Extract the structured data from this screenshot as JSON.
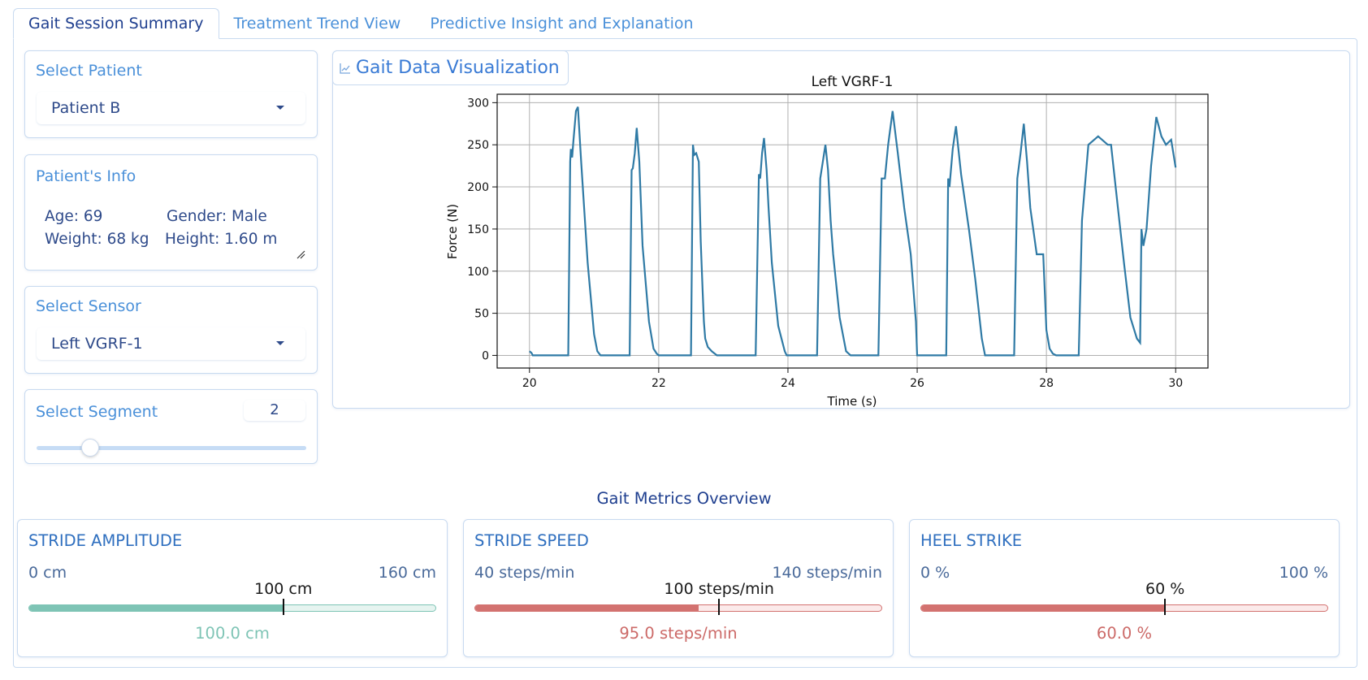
{
  "tabs": [
    {
      "label": "Gait Session Summary",
      "active": true
    },
    {
      "label": "Treatment Trend View",
      "active": false
    },
    {
      "label": "Predictive Insight and Explanation",
      "active": false
    }
  ],
  "patient_select": {
    "title": "Select Patient",
    "value": "Patient B"
  },
  "patient_info": {
    "title": "Patient's Info",
    "age": "Age: 69",
    "gender": "Gender: Male",
    "weight": "Weight: 68 kg",
    "height": "Height: 1.60 m"
  },
  "sensor_select": {
    "title": "Select Sensor",
    "value": "Left VGRF-1"
  },
  "segment": {
    "title": "Select Segment",
    "value": "2",
    "level_fraction": 0.2
  },
  "visualization": {
    "header_icon": "chart-icon",
    "title": "Gait Data Visualization"
  },
  "metrics_title": "Gait Metrics Overview",
  "metrics": [
    {
      "name": "stride-amplitude",
      "title": "STRIDE AMPLITUDE",
      "min_label": "0 cm",
      "max_label": "160 cm",
      "min": 0,
      "max": 160,
      "reference": 100,
      "reference_label": "100 cm",
      "value": 100,
      "value_label": "100.0 cm",
      "color": "#7ec4b5",
      "track_color": "#e6f4f0",
      "text_color": "#7ec4b5"
    },
    {
      "name": "stride-speed",
      "title": "STRIDE SPEED",
      "min_label": "40 steps/min",
      "max_label": "140 steps/min",
      "min": 40,
      "max": 140,
      "reference": 100,
      "reference_label": "100 steps/min",
      "value": 95,
      "value_label": "95.0 steps/min",
      "color": "#d37270",
      "track_color": "#fbeaea",
      "text_color": "#cc6a68"
    },
    {
      "name": "heel-strike",
      "title": "HEEL STRIKE",
      "min_label": "0 %",
      "max_label": "100 %",
      "min": 0,
      "max": 100,
      "reference": 60,
      "reference_label": "60 %",
      "value": 60,
      "value_label": "60.0 %",
      "color": "#d37270",
      "track_color": "#fbeaea",
      "text_color": "#cc6a68"
    }
  ],
  "chart_data": {
    "type": "line",
    "title": "Left VGRF-1",
    "xlabel": "Time (s)",
    "ylabel": "Force (N)",
    "xlim": [
      19.5,
      30.5
    ],
    "ylim": [
      -15,
      310
    ],
    "xticks": [
      20,
      22,
      24,
      26,
      28,
      30
    ],
    "yticks": [
      0,
      50,
      100,
      150,
      200,
      250,
      300
    ],
    "grid": true,
    "line_color": "#2f7aa5",
    "x": [
      20.0,
      20.03,
      20.05,
      20.6,
      20.63,
      20.64,
      20.66,
      20.68,
      20.72,
      20.75,
      20.8,
      20.9,
      21.0,
      21.05,
      21.1,
      21.12,
      21.4,
      21.55,
      21.58,
      21.6,
      21.63,
      21.66,
      21.7,
      21.75,
      21.85,
      21.92,
      21.97,
      22.0,
      22.5,
      22.53,
      22.55,
      22.58,
      22.62,
      22.65,
      22.68,
      22.7,
      22.72,
      22.76,
      22.82,
      22.9,
      23.0,
      23.03,
      23.5,
      23.55,
      23.57,
      23.6,
      23.63,
      23.67,
      23.7,
      23.75,
      23.85,
      23.95,
      23.98,
      24.45,
      24.5,
      24.55,
      24.58,
      24.62,
      24.66,
      24.7,
      24.8,
      24.9,
      24.97,
      25.0,
      25.4,
      25.45,
      25.5,
      25.55,
      25.62,
      25.7,
      25.8,
      25.9,
      25.98,
      26.0,
      26.45,
      26.48,
      26.5,
      26.55,
      26.6,
      26.68,
      26.8,
      26.9,
      27.0,
      27.05,
      27.5,
      27.55,
      27.6,
      27.65,
      27.7,
      27.75,
      27.85,
      27.95,
      28.0,
      28.05,
      28.1,
      28.15,
      28.2,
      28.5,
      28.55,
      28.65,
      28.8,
      28.95,
      29.0,
      29.1,
      29.2,
      29.3,
      29.4,
      29.45,
      29.47,
      29.5,
      29.55,
      29.62,
      29.7,
      29.78,
      29.85,
      29.93,
      30.0
    ],
    "values": [
      5,
      3,
      0,
      0,
      230,
      245,
      235,
      255,
      290,
      295,
      230,
      110,
      25,
      5,
      0,
      0,
      0,
      0,
      220,
      222,
      240,
      270,
      230,
      130,
      40,
      8,
      2,
      0,
      0,
      250,
      238,
      240,
      230,
      135,
      75,
      40,
      20,
      10,
      5,
      0,
      0,
      0,
      0,
      215,
      210,
      240,
      258,
      220,
      175,
      110,
      35,
      5,
      0,
      0,
      210,
      235,
      250,
      220,
      160,
      120,
      45,
      5,
      0,
      0,
      0,
      210,
      210,
      250,
      290,
      240,
      175,
      120,
      40,
      0,
      0,
      210,
      200,
      245,
      272,
      215,
      150,
      90,
      20,
      0,
      0,
      210,
      240,
      275,
      230,
      175,
      120,
      120,
      30,
      8,
      2,
      0,
      0,
      0,
      160,
      250,
      260,
      250,
      250,
      180,
      110,
      45,
      20,
      15,
      150,
      130,
      150,
      225,
      283,
      260,
      250,
      256,
      223
    ]
  }
}
